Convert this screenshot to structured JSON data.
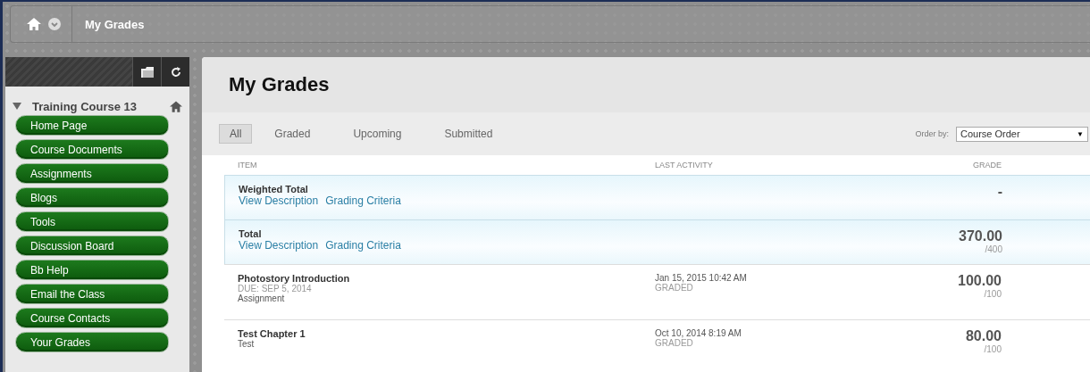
{
  "breadcrumb": {
    "title": "My Grades"
  },
  "course": {
    "title": "Training Course 13",
    "expanded": true
  },
  "menu": [
    {
      "label": "Home Page"
    },
    {
      "label": "Course Documents"
    },
    {
      "label": "Assignments"
    },
    {
      "label": "Blogs"
    },
    {
      "label": "Tools"
    },
    {
      "label": "Discussion Board"
    },
    {
      "label": "Bb Help"
    },
    {
      "label": "Email the Class"
    },
    {
      "label": "Course Contacts"
    },
    {
      "label": "Your Grades"
    }
  ],
  "page": {
    "title": "My Grades"
  },
  "tabs": [
    {
      "label": "All",
      "selected": true
    },
    {
      "label": "Graded",
      "selected": false
    },
    {
      "label": "Upcoming",
      "selected": false
    },
    {
      "label": "Submitted",
      "selected": false
    }
  ],
  "order": {
    "label": "Order by:",
    "value": "Course Order",
    "arrow": "▼"
  },
  "table": {
    "columns": [
      "ITEM",
      "LAST ACTIVITY",
      "GRADE"
    ],
    "rows": [
      {
        "title": "Weighted Total",
        "links": [
          "View Description",
          "Grading Criteria"
        ],
        "grade": "-",
        "highlighted": true
      },
      {
        "title": "Total",
        "links": [
          "View Description",
          "Grading Criteria"
        ],
        "grade": "370.00",
        "points": "/400",
        "highlighted": true
      },
      {
        "title": "Photostory Introduction",
        "due": "DUE: SEP 5, 2014",
        "type": "Assignment",
        "activity": "Jan 15, 2015 10:42 AM",
        "status": "GRADED",
        "grade": "100.00",
        "points": "/100",
        "highlighted": false
      },
      {
        "title": "Test Chapter 1",
        "type": "Test",
        "activity": "Oct 10, 2014 8:19 AM",
        "status": "GRADED",
        "grade": "80.00",
        "points": "/100",
        "highlighted": false
      }
    ]
  }
}
